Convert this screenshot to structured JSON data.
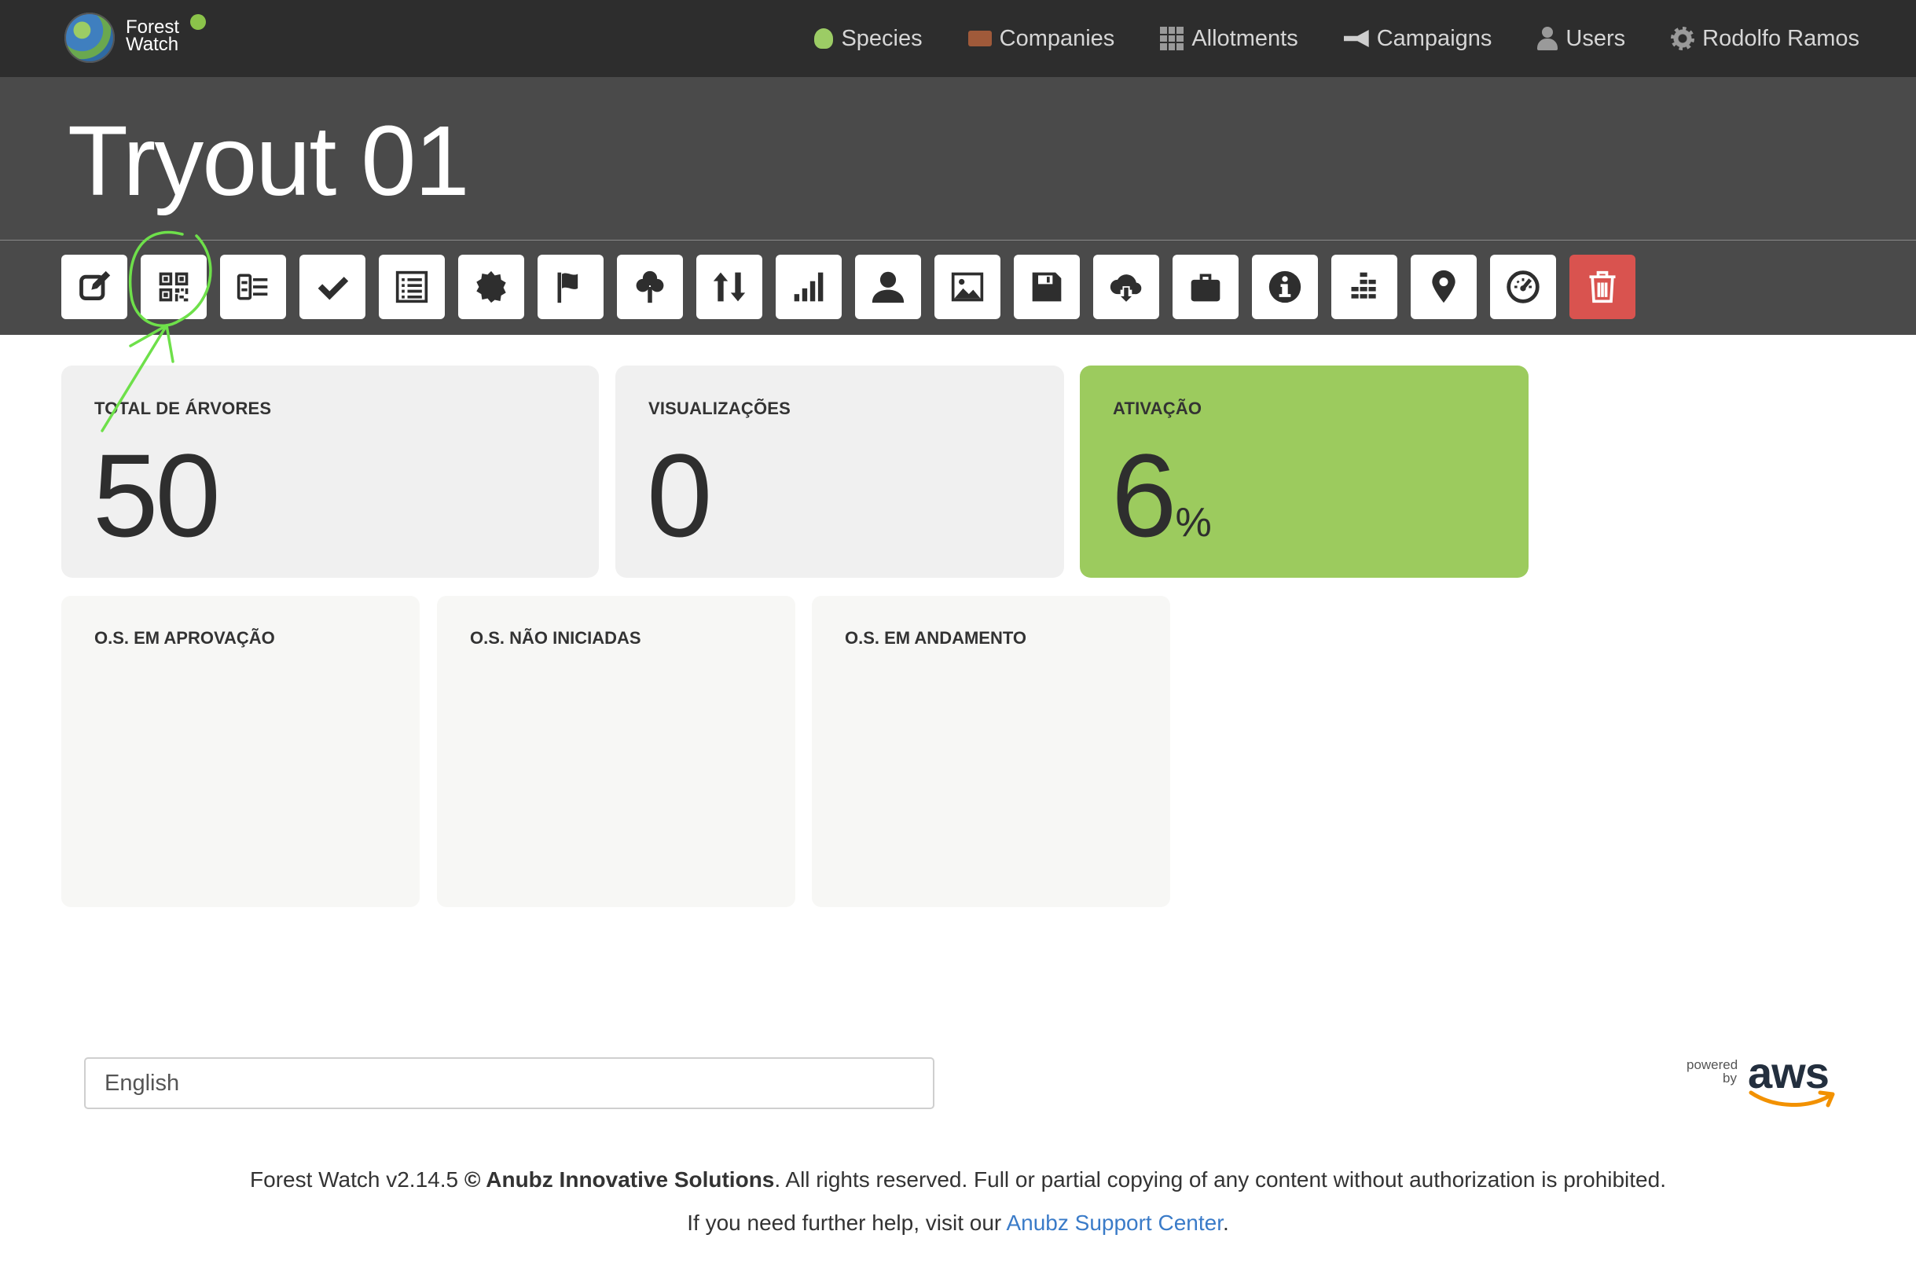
{
  "brand": {
    "line1": "Forest",
    "line2": "Watch"
  },
  "nav": {
    "items": [
      {
        "label": "Species",
        "icon": "leaf-icon"
      },
      {
        "label": "Companies",
        "icon": "briefcase-icon"
      },
      {
        "label": "Allotments",
        "icon": "grid-icon"
      },
      {
        "label": "Campaigns",
        "icon": "megaphone-icon"
      },
      {
        "label": "Users",
        "icon": "user-icon"
      },
      {
        "label": "Rodolfo Ramos",
        "icon": "gear-icon"
      }
    ]
  },
  "page": {
    "title": "Tryout 01"
  },
  "toolbar": {
    "buttons": [
      "edit-icon",
      "qr-code-icon",
      "id-card-icon",
      "check-icon",
      "list-icon",
      "certificate-icon",
      "flag-icon",
      "tree-icon",
      "sort-icon",
      "bar-chart-icon",
      "user-icon",
      "image-icon",
      "save-icon",
      "cloud-download-icon",
      "briefcase-icon",
      "info-icon",
      "bars-rising-icon",
      "map-marker-icon",
      "dashboard-icon",
      "trash-icon"
    ]
  },
  "stats": {
    "trees": {
      "label": "TOTAL DE ÁRVORES",
      "value": "50"
    },
    "views": {
      "label": "VISUALIZAÇÕES",
      "value": "0"
    },
    "activation": {
      "label": "ATIVAÇÃO",
      "value": "6",
      "unit": "%"
    }
  },
  "orders": {
    "approval": {
      "label": "O.S. EM APROVAÇÃO"
    },
    "not_started": {
      "label": "O.S. NÃO INICIADAS"
    },
    "in_progress": {
      "label": "O.S. EM ANDAMENTO"
    }
  },
  "footer": {
    "language": "English",
    "aws_powered": "powered",
    "aws_by": "by",
    "aws_logo": "aws",
    "version": "Forest Watch v2.14.5",
    "company": "© Anubz Innovative Solutions",
    "rights": ". All rights reserved. Full or partial copying of any content without authorization is prohibited.",
    "help_prefix": "If you need further help, visit our ",
    "help_link": "Anubz Support Center",
    "help_suffix": "."
  },
  "colors": {
    "topbar": "#2d2d2d",
    "header": "#4a4a4a",
    "accent_green": "#9ccb5e",
    "danger": "#d9534f",
    "link": "#3a7bc8"
  }
}
